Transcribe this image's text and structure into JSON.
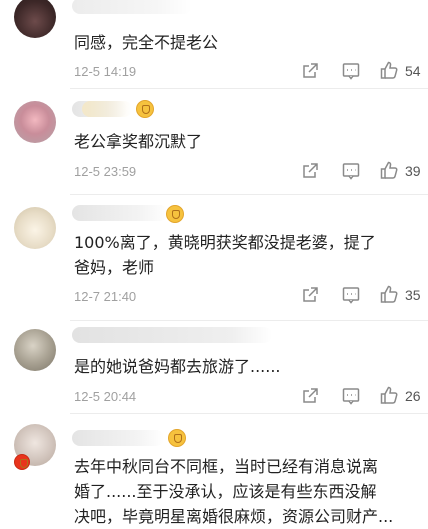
{
  "comments": [
    {
      "text": "同感，完全不提老公",
      "time": "12-5 14:19",
      "likes": "54"
    },
    {
      "text": "老公拿奖都沉默了",
      "time": "12-5 23:59",
      "likes": "39"
    },
    {
      "text_line1": "100%离了，黄晓明获奖都没提老婆，提了",
      "text_line2": "爸妈，老师",
      "time": "12-7 21:40",
      "likes": "35"
    },
    {
      "text": "是的她说爸妈都去旅游了......",
      "time": "12-5 20:44",
      "likes": "26"
    },
    {
      "text_line1": "去年中秋同台不同框，当时已经有消息说离",
      "text_line2": "婚了......至于没承认，应该是有些东西没解",
      "text_line3": "决吧，毕竟明星离婚很麻烦，资源公司财产..."
    }
  ],
  "icons": {
    "share": "share-icon",
    "comment": "comment-icon",
    "like": "thumbs-up-icon",
    "vip": "vip-badge-icon"
  },
  "colors": {
    "text": "#222222",
    "meta": "#a0a0a0",
    "divider": "#ececec",
    "vip": "#f6c23e"
  }
}
